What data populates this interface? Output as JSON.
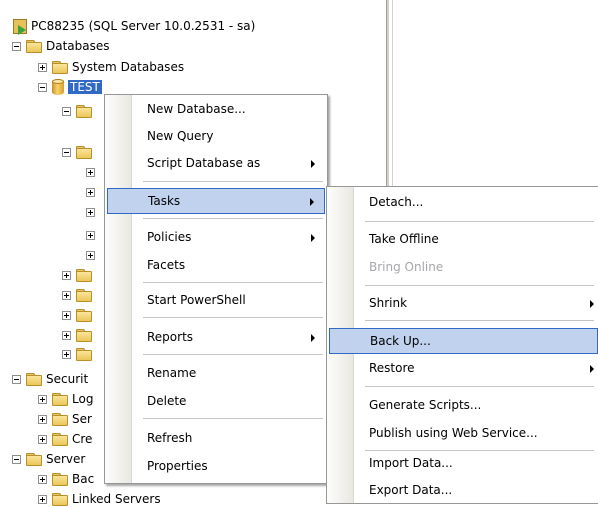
{
  "tree": {
    "server": "PC88235 (SQL Server 10.0.2531 - sa)",
    "databases": "Databases",
    "system_databases": "System Databases",
    "test_db": "TEST",
    "security": "Securit",
    "security_children": [
      "Log",
      "Ser",
      "Cre"
    ],
    "server_objects": "Server",
    "server_children": [
      "Bac",
      "Linked Servers"
    ]
  },
  "context_menu": {
    "items": [
      "New Database...",
      "New Query",
      "Script Database as",
      "Tasks",
      "Policies",
      "Facets",
      "Start PowerShell",
      "Reports",
      "Rename",
      "Delete",
      "Refresh",
      "Properties"
    ],
    "highlighted": "Tasks"
  },
  "tasks_submenu": {
    "items": [
      "Detach...",
      "Take Offline",
      "Bring Online",
      "Shrink",
      "Back Up...",
      "Restore",
      "Generate Scripts...",
      "Publish using Web Service...",
      "Import Data...",
      "Export Data..."
    ],
    "highlighted": "Back Up...",
    "disabled": [
      "Bring Online"
    ]
  },
  "colors": {
    "highlight_fill": "#c1d2ee",
    "highlight_border": "#316ac5",
    "selection": "#316ac5",
    "folder": "#eac65a"
  }
}
